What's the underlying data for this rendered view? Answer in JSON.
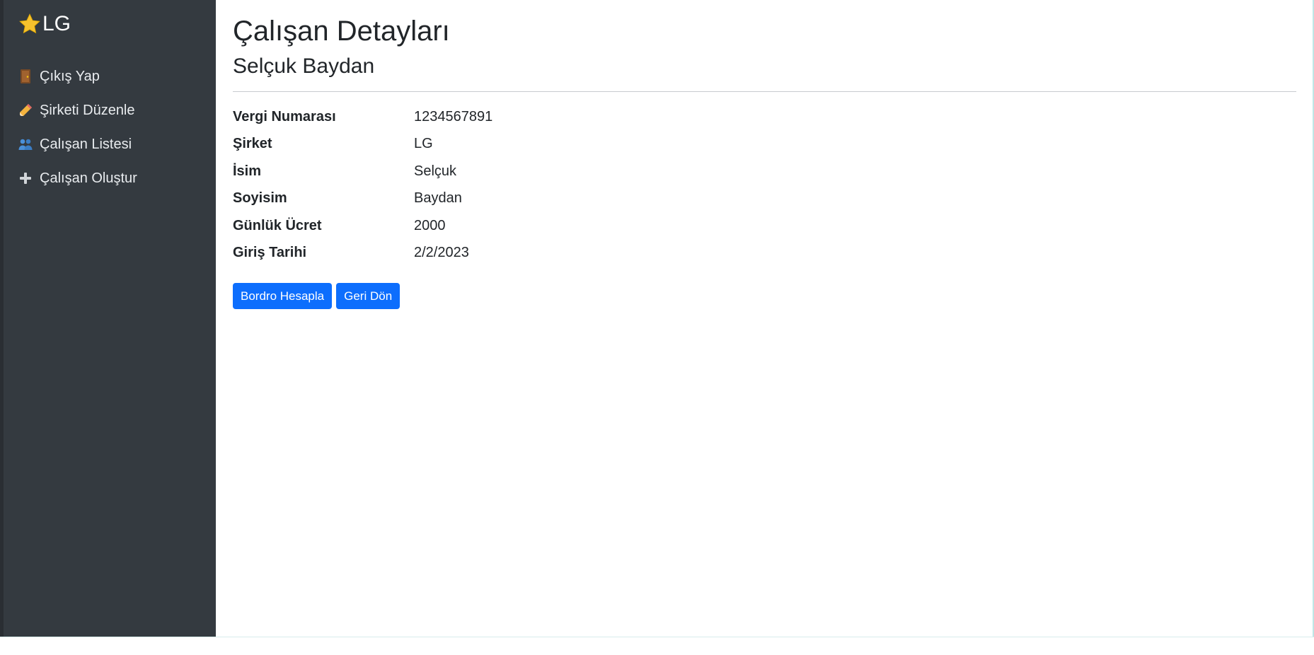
{
  "sidebar": {
    "brand": "LG",
    "brand_icon": "star-icon",
    "items": [
      {
        "icon": "door-icon",
        "label": "Çıkış Yap"
      },
      {
        "icon": "pencil-icon",
        "label": "Şirketi Düzenle"
      },
      {
        "icon": "people-icon",
        "label": "Çalışan Listesi"
      },
      {
        "icon": "plus-icon",
        "label": "Çalışan Oluştur"
      }
    ]
  },
  "main": {
    "title": "Çalışan Detayları",
    "employee_name": "Selçuk Baydan",
    "details": [
      {
        "label": "Vergi Numarası",
        "value": "1234567891"
      },
      {
        "label": "Şirket",
        "value": "LG"
      },
      {
        "label": "İsim",
        "value": "Selçuk"
      },
      {
        "label": "Soyisim",
        "value": "Baydan"
      },
      {
        "label": "Günlük Ücret",
        "value": "2000"
      },
      {
        "label": "Giriş Tarihi",
        "value": "2/2/2023"
      }
    ],
    "buttons": {
      "payroll": "Bordro Hesapla",
      "back": "Geri Dön"
    }
  },
  "colors": {
    "sidebar_bg": "#343a40",
    "primary": "#0d6efd",
    "star": "#f7c22d"
  }
}
